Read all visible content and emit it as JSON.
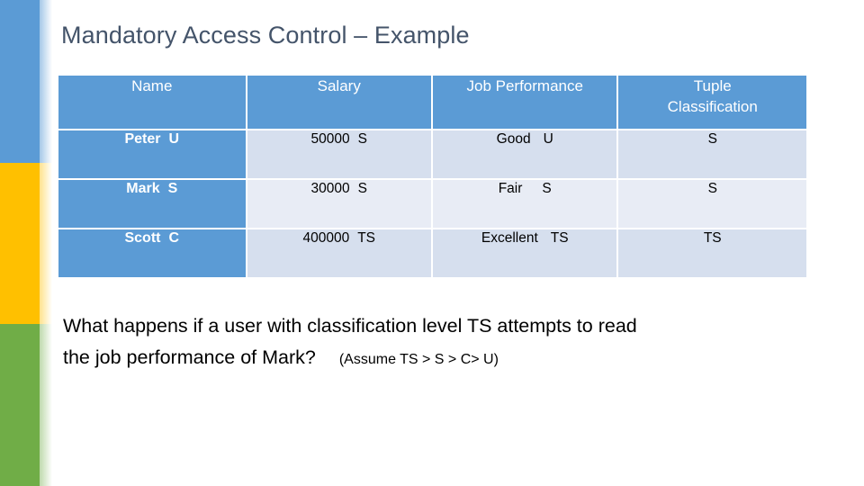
{
  "slide": {
    "title": "Mandatory Access Control – Example",
    "title_color": "#44546a"
  },
  "stripe": {
    "blue": "#5b9bd5",
    "yellow": "#ffc000",
    "green": "#70ad47"
  },
  "table": {
    "header_bg": "#5b9bd5",
    "header_text_color": "#ffffff",
    "row_band_a": "#d6dfee",
    "row_band_b": "#e8ecf5",
    "headers": {
      "name": "Name",
      "salary": "Salary",
      "job_performance": "Job Performance",
      "tuple_classification_line1": "Tuple",
      "tuple_classification_line2": "Classification"
    },
    "rows": [
      {
        "name": "Peter",
        "name_class": "U",
        "salary": "50000",
        "salary_class": "S",
        "performance": "Good",
        "performance_class": "U",
        "tuple_classification": "S"
      },
      {
        "name": "Mark",
        "name_class": "S",
        "salary": "30000",
        "salary_class": "S",
        "performance": "Fair",
        "performance_class": "S",
        "tuple_classification": "S"
      },
      {
        "name": "Scott",
        "name_class": "C",
        "salary": "400000",
        "salary_class": "TS",
        "performance": "Excellent",
        "performance_class": "TS",
        "tuple_classification": "TS"
      }
    ]
  },
  "question": {
    "line1": "What happens if a user with classification level TS attempts to read",
    "line2": "the job performance of Mark?",
    "assumption": "(Assume TS > S > C> U)"
  }
}
